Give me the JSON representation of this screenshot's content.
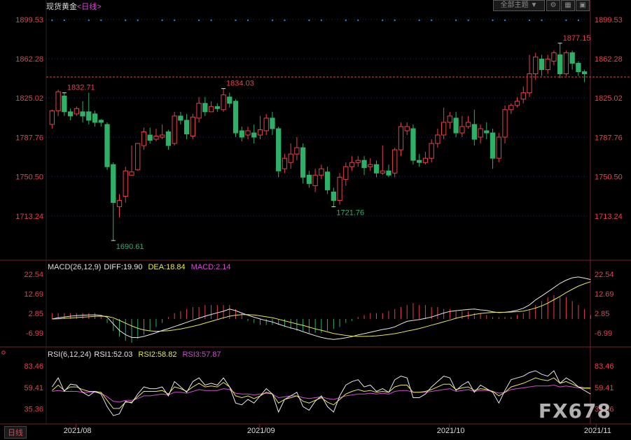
{
  "header": {
    "symbol": "现货黄金",
    "period": "<日线>",
    "theme_button": "全部主题",
    "theme_arrow": "▼"
  },
  "footer": {
    "period_label": "日线"
  },
  "watermark": "FX678",
  "colors": {
    "up": "#e8404a",
    "down": "#2fb068",
    "grid": "#1e2a4a",
    "axis": "#e8404a",
    "last_price_line": "#e8404a"
  },
  "chart_data": [
    {
      "type": "candlestick",
      "panel": "price",
      "title": "",
      "ylim": [
        1676,
        1906
      ],
      "y_ticks": [
        1899.53,
        1862.28,
        1825.02,
        1787.76,
        1750.5,
        1713.24
      ],
      "x_ticks": [
        "2021/08",
        "2021/09",
        "2021/10",
        "2021/11"
      ],
      "annotations": [
        {
          "text": "1832.71",
          "type": "high"
        },
        {
          "text": "1690.61",
          "type": "low"
        },
        {
          "text": "1834.03",
          "type": "high"
        },
        {
          "text": "1721.76",
          "type": "low"
        },
        {
          "text": "1877.15",
          "type": "high"
        }
      ],
      "last_price": 1845,
      "candles": [
        [
          1800,
          1813,
          1796,
          1814
        ],
        [
          1813,
          1831,
          1808,
          1833
        ],
        [
          1827,
          1812,
          1808,
          1830
        ],
        [
          1812,
          1808,
          1804,
          1815
        ],
        [
          1810,
          1815,
          1808,
          1817
        ],
        [
          1812,
          1808,
          1802,
          1822
        ],
        [
          1812,
          1804,
          1800,
          1830
        ],
        [
          1810,
          1802,
          1798,
          1813
        ],
        [
          1804,
          1802,
          1798,
          1805
        ],
        [
          1800,
          1760,
          1757,
          1802
        ],
        [
          1762,
          1726,
          1690,
          1764
        ],
        [
          1722,
          1728,
          1712,
          1734
        ],
        [
          1732,
          1756,
          1726,
          1760
        ],
        [
          1752,
          1755,
          1752,
          1780
        ],
        [
          1757,
          1782,
          1756,
          1782
        ],
        [
          1780,
          1793,
          1776,
          1797
        ],
        [
          1790,
          1785,
          1782,
          1797
        ],
        [
          1786,
          1789,
          1784,
          1796
        ],
        [
          1788,
          1790,
          1786,
          1800
        ],
        [
          1793,
          1780,
          1776,
          1795
        ],
        [
          1782,
          1808,
          1780,
          1812
        ],
        [
          1808,
          1804,
          1800,
          1812
        ],
        [
          1804,
          1791,
          1786,
          1810
        ],
        [
          1789,
          1807,
          1786,
          1810
        ],
        [
          1806,
          1820,
          1802,
          1826
        ],
        [
          1820,
          1812,
          1808,
          1826
        ],
        [
          1812,
          1817,
          1812,
          1822
        ],
        [
          1817,
          1815,
          1812,
          1820
        ],
        [
          1814,
          1828,
          1812,
          1834
        ],
        [
          1826,
          1820,
          1816,
          1830
        ],
        [
          1822,
          1792,
          1788,
          1824
        ],
        [
          1794,
          1788,
          1784,
          1798
        ],
        [
          1790,
          1794,
          1786,
          1798
        ],
        [
          1792,
          1788,
          1782,
          1800
        ],
        [
          1790,
          1795,
          1786,
          1808
        ],
        [
          1794,
          1806,
          1790,
          1810
        ],
        [
          1806,
          1796,
          1790,
          1812
        ],
        [
          1796,
          1756,
          1750,
          1798
        ],
        [
          1758,
          1768,
          1754,
          1772
        ],
        [
          1764,
          1772,
          1758,
          1782
        ],
        [
          1772,
          1778,
          1766,
          1788
        ],
        [
          1778,
          1750,
          1744,
          1782
        ],
        [
          1752,
          1744,
          1740,
          1756
        ],
        [
          1742,
          1752,
          1736,
          1758
        ],
        [
          1752,
          1758,
          1748,
          1762
        ],
        [
          1755,
          1738,
          1734,
          1760
        ],
        [
          1736,
          1728,
          1722,
          1740
        ],
        [
          1728,
          1750,
          1724,
          1754
        ],
        [
          1748,
          1760,
          1742,
          1764
        ],
        [
          1760,
          1764,
          1756,
          1770
        ],
        [
          1764,
          1766,
          1760,
          1770
        ],
        [
          1766,
          1759,
          1752,
          1770
        ],
        [
          1760,
          1762,
          1756,
          1768
        ],
        [
          1762,
          1754,
          1750,
          1766
        ],
        [
          1754,
          1756,
          1752,
          1780
        ],
        [
          1756,
          1752,
          1750,
          1762
        ],
        [
          1754,
          1776,
          1750,
          1778
        ],
        [
          1776,
          1798,
          1770,
          1802
        ],
        [
          1794,
          1798,
          1790,
          1802
        ],
        [
          1796,
          1766,
          1762,
          1800
        ],
        [
          1766,
          1764,
          1760,
          1772
        ],
        [
          1764,
          1768,
          1762,
          1774
        ],
        [
          1768,
          1782,
          1764,
          1786
        ],
        [
          1782,
          1790,
          1778,
          1796
        ],
        [
          1790,
          1802,
          1786,
          1816
        ],
        [
          1802,
          1808,
          1796,
          1812
        ],
        [
          1806,
          1792,
          1788,
          1812
        ],
        [
          1792,
          1798,
          1788,
          1808
        ],
        [
          1798,
          1802,
          1796,
          1808
        ],
        [
          1800,
          1786,
          1780,
          1814
        ],
        [
          1788,
          1796,
          1782,
          1800
        ],
        [
          1794,
          1792,
          1786,
          1802
        ],
        [
          1792,
          1768,
          1758,
          1796
        ],
        [
          1768,
          1788,
          1764,
          1792
        ],
        [
          1788,
          1814,
          1782,
          1818
        ],
        [
          1814,
          1818,
          1810,
          1820
        ],
        [
          1818,
          1822,
          1816,
          1826
        ],
        [
          1824,
          1830,
          1820,
          1836
        ],
        [
          1830,
          1848,
          1826,
          1866
        ],
        [
          1848,
          1864,
          1842,
          1868
        ],
        [
          1862,
          1852,
          1846,
          1866
        ],
        [
          1852,
          1862,
          1848,
          1866
        ],
        [
          1860,
          1868,
          1856,
          1870
        ],
        [
          1866,
          1848,
          1844,
          1877
        ],
        [
          1848,
          1868,
          1846,
          1870
        ],
        [
          1868,
          1858,
          1852,
          1870
        ],
        [
          1858,
          1850,
          1846,
          1860
        ],
        [
          1850,
          1848,
          1840,
          1852
        ]
      ]
    },
    {
      "type": "line",
      "panel": "macd",
      "title": "MACD(26,12,9)",
      "legend": [
        {
          "name": "DIFF",
          "value": "19.90",
          "color": "#e8e8e8"
        },
        {
          "name": "DEA",
          "value": "18.84",
          "color": "#e8e855"
        },
        {
          "name": "MACD",
          "value": "2.14",
          "color": "#d050d0"
        }
      ],
      "ylim": [
        -12,
        24
      ],
      "y_ticks": [
        22.54,
        12.69,
        2.85,
        -6.99
      ],
      "diff": [
        0,
        0.6,
        1.0,
        1.4,
        1.7,
        1.9,
        2.0,
        2.1,
        1.8,
        0.9,
        -2.5,
        -5.8,
        -7.9,
        -9.3,
        -9.4,
        -8.8,
        -7.9,
        -6.9,
        -5.8,
        -4.9,
        -3.8,
        -2.8,
        -1.7,
        -0.6,
        0.4,
        1.4,
        2.3,
        3.1,
        3.9,
        5.0,
        4.2,
        3.0,
        1.9,
        0.9,
        0.0,
        -0.8,
        -1.5,
        -2.6,
        -3.6,
        -4.5,
        -5.3,
        -6.4,
        -7.4,
        -8.4,
        -9.3,
        -9.9,
        -10.3,
        -10.0,
        -9.5,
        -8.9,
        -8.0,
        -7.4,
        -6.7,
        -6.0,
        -5.3,
        -4.8,
        -4.0,
        -2.5,
        -1.2,
        -0.7,
        -0.3,
        0.3,
        1.0,
        2.0,
        3.0,
        3.8,
        4.2,
        4.5,
        4.8,
        5.0,
        4.6,
        4.3,
        3.6,
        3.2,
        3.4,
        3.8,
        4.4,
        5.4,
        7.1,
        9.6,
        11.6,
        13.7,
        15.8,
        18.0,
        19.6,
        20.8,
        21.2,
        20.6,
        19.9
      ],
      "dea": [
        0,
        0.1,
        0.3,
        0.5,
        0.7,
        0.9,
        1.1,
        1.3,
        1.4,
        1.3,
        0.6,
        -0.7,
        -2.1,
        -3.5,
        -4.7,
        -5.5,
        -6.0,
        -6.2,
        -6.1,
        -5.9,
        -5.5,
        -5.0,
        -4.4,
        -3.7,
        -3.0,
        -2.1,
        -1.2,
        -0.3,
        0.6,
        1.4,
        1.9,
        2.2,
        2.2,
        2.0,
        1.6,
        1.1,
        0.6,
        -0.1,
        -0.9,
        -1.7,
        -2.5,
        -3.2,
        -4.1,
        -5.0,
        -5.7,
        -6.5,
        -7.3,
        -7.8,
        -8.3,
        -8.6,
        -8.8,
        -8.8,
        -8.7,
        -8.5,
        -8.2,
        -7.8,
        -7.4,
        -6.8,
        -6.1,
        -5.5,
        -4.8,
        -4.0,
        -3.1,
        -2.3,
        -1.4,
        -0.6,
        0.4,
        1.1,
        1.7,
        2.3,
        2.8,
        3.1,
        3.3,
        3.4,
        3.4,
        3.5,
        3.7,
        4.0,
        4.7,
        5.5,
        6.6,
        8.0,
        9.7,
        11.4,
        13.3,
        15.0,
        16.6,
        17.8,
        18.8
      ],
      "hist": [
        3.0,
        3.0,
        3.0,
        3.0,
        3.0,
        3.0,
        3.0,
        3.0,
        1.0,
        -2.0,
        -6.0,
        -9.0,
        -11.0,
        -12.0,
        -10.0,
        -8.0,
        -6.0,
        -4.0,
        -2.0,
        1.0,
        3.0,
        4.0,
        5.0,
        6.0,
        6.0,
        7.0,
        7.0,
        7.0,
        7.0,
        7.0,
        5.0,
        3.0,
        -1.0,
        -2.0,
        -3.0,
        -3.0,
        -3.0,
        -3.0,
        -4.0,
        -5.0,
        -6.0,
        -6.0,
        -7.0,
        -7.0,
        -7.0,
        -6.0,
        -5.0,
        -4.0,
        -2.0,
        -1.0,
        1.0,
        2.0,
        3.0,
        3.0,
        3.0,
        4.0,
        5.0,
        6.0,
        7.0,
        8.0,
        7.0,
        7.0,
        6.0,
        6.0,
        5.0,
        5.0,
        4.0,
        4.0,
        4.0,
        3.0,
        3.0,
        2.0,
        1.0,
        1.0,
        1.0,
        1.0,
        2.0,
        3.0,
        5.0,
        7.0,
        9.0,
        11.0,
        12.0,
        11.0,
        11.0,
        9.0,
        7.0,
        5.0,
        2.0
      ]
    },
    {
      "type": "line",
      "panel": "rsi",
      "title": "RSI(6,12,24)",
      "legend": [
        {
          "name": "RSI1",
          "value": "52.03",
          "color": "#e8e8e8"
        },
        {
          "name": "RSI2",
          "value": "58.82",
          "color": "#e8e855"
        },
        {
          "name": "RSI3",
          "value": "57.87",
          "color": "#d050d0"
        }
      ],
      "ylim": [
        25,
        92
      ],
      "y_ticks": [
        83.46,
        59.41,
        35.36
      ],
      "rsi6": [
        60,
        70,
        55,
        63,
        62,
        54,
        50,
        55,
        52,
        38,
        28,
        30,
        44,
        42,
        52,
        60,
        58,
        58,
        60,
        50,
        66,
        60,
        54,
        66,
        70,
        62,
        64,
        62,
        70,
        60,
        42,
        40,
        46,
        42,
        50,
        58,
        52,
        32,
        46,
        50,
        54,
        38,
        34,
        44,
        50,
        38,
        32,
        50,
        62,
        66,
        68,
        60,
        62,
        55,
        58,
        54,
        68,
        72,
        70,
        48,
        48,
        52,
        60,
        66,
        72,
        70,
        56,
        62,
        66,
        54,
        62,
        58,
        54,
        42,
        56,
        68,
        70,
        72,
        76,
        78,
        74,
        72,
        78,
        64,
        70,
        66,
        60,
        56,
        52
      ],
      "rsi12": [
        56,
        62,
        56,
        60,
        60,
        57,
        55,
        55,
        54,
        45,
        36,
        36,
        43,
        43,
        49,
        55,
        55,
        55,
        56,
        52,
        60,
        58,
        55,
        60,
        64,
        60,
        61,
        60,
        65,
        60,
        50,
        48,
        50,
        47,
        50,
        54,
        52,
        42,
        46,
        48,
        50,
        44,
        42,
        45,
        48,
        43,
        40,
        46,
        52,
        55,
        57,
        55,
        56,
        54,
        55,
        54,
        60,
        62,
        62,
        54,
        54,
        55,
        57,
        60,
        63,
        63,
        57,
        59,
        60,
        56,
        58,
        57,
        55,
        50,
        54,
        60,
        62,
        64,
        67,
        70,
        68,
        67,
        70,
        64,
        66,
        63,
        60,
        59,
        58.8
      ],
      "rsi24": [
        55,
        56,
        55,
        55,
        55,
        54,
        54,
        54,
        53,
        49,
        44,
        43,
        45,
        45,
        47,
        50,
        50,
        51,
        52,
        51,
        54,
        54,
        53,
        55,
        57,
        56,
        56,
        56,
        58,
        57,
        53,
        52,
        52,
        51,
        52,
        53,
        52,
        48,
        49,
        50,
        50,
        48,
        47,
        48,
        49,
        47,
        46,
        48,
        50,
        51,
        52,
        52,
        53,
        52,
        53,
        52,
        55,
        56,
        56,
        54,
        54,
        54,
        55,
        56,
        57,
        58,
        55,
        56,
        57,
        55,
        56,
        56,
        55,
        53,
        54,
        57,
        58,
        59,
        60,
        61,
        61,
        61,
        62,
        60,
        61,
        60,
        59,
        58,
        57.9
      ]
    }
  ]
}
